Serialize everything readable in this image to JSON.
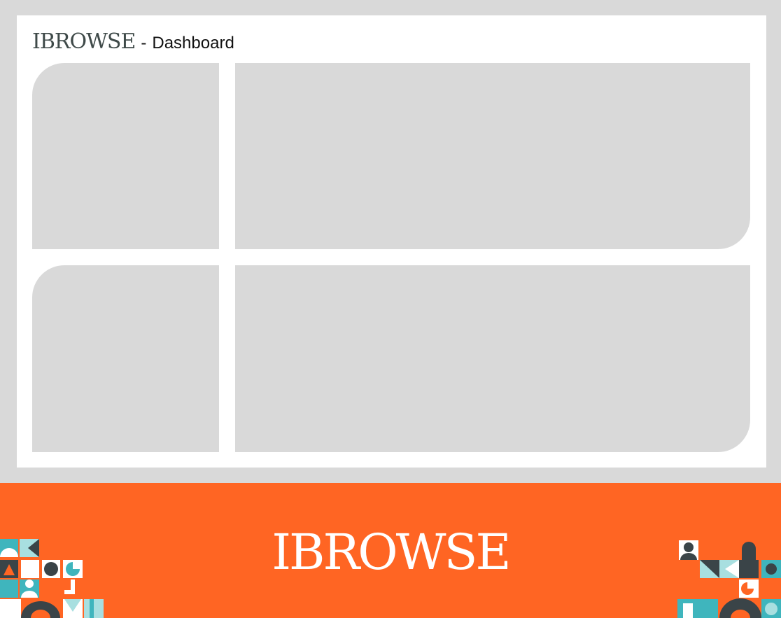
{
  "header": {
    "brand": "IBROWSE",
    "separator": "-",
    "subtitle": "Dashboard"
  },
  "footer": {
    "brand": "IBROWSE"
  },
  "colors": {
    "background": "#d9d9d9",
    "card": "#ffffff",
    "brand_text": "#3f4a49",
    "footer_orange": "#ff6523",
    "teal": "#3fb5bd",
    "light_teal": "#a8dfe0",
    "dark_slate": "#3a4448"
  },
  "icons": [
    "geometric-pattern-left-icon",
    "geometric-pattern-right-icon"
  ]
}
